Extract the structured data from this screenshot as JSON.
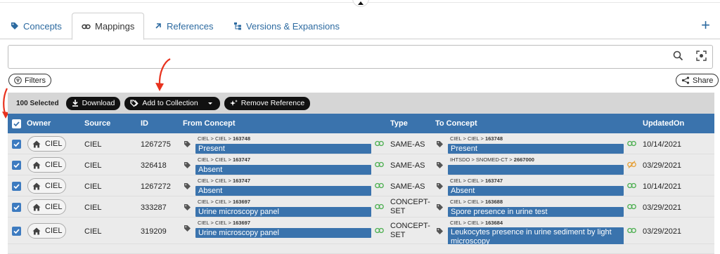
{
  "tabs": [
    {
      "label": "Concepts",
      "icon": "tag-icon"
    },
    {
      "label": "Mappings",
      "icon": "link-icon"
    },
    {
      "label": "References",
      "icon": "reference-icon"
    },
    {
      "label": "Versions & Expansions",
      "icon": "tree-icon"
    }
  ],
  "search": {
    "value": "",
    "placeholder": ""
  },
  "filters_label": "Filters",
  "share_label": "Share",
  "actions": {
    "selected": "100 Selected",
    "download": "Download",
    "add_to_collection": "Add to Collection",
    "remove_reference": "Remove Reference"
  },
  "columns": {
    "owner": "Owner",
    "source": "Source",
    "id": "ID",
    "from_concept": "From Concept",
    "type": "Type",
    "to_concept": "To Concept",
    "updated_on": "UpdatedOn"
  },
  "sep": ">",
  "rows": [
    {
      "owner": "CIEL",
      "source": "CIEL",
      "id": "1267275",
      "from": {
        "org": "CIEL",
        "src": "CIEL",
        "code": "163748",
        "name": "Present"
      },
      "type": "SAME-AS",
      "to": {
        "org": "CIEL",
        "src": "CIEL",
        "code": "163748",
        "name": "Present"
      },
      "to_link_status": "linked",
      "updated": "10/14/2021"
    },
    {
      "owner": "CIEL",
      "source": "CIEL",
      "id": "326418",
      "from": {
        "org": "CIEL",
        "src": "CIEL",
        "code": "163747",
        "name": "Absent"
      },
      "type": "SAME-AS",
      "to": {
        "org": "IHTSDO",
        "src": "SNOMED-CT",
        "code": "2667000",
        "name": ""
      },
      "to_link_status": "broken",
      "updated": "03/29/2021"
    },
    {
      "owner": "CIEL",
      "source": "CIEL",
      "id": "1267272",
      "from": {
        "org": "CIEL",
        "src": "CIEL",
        "code": "163747",
        "name": "Absent"
      },
      "type": "SAME-AS",
      "to": {
        "org": "CIEL",
        "src": "CIEL",
        "code": "163747",
        "name": "Absent"
      },
      "to_link_status": "linked",
      "updated": "10/14/2021"
    },
    {
      "owner": "CIEL",
      "source": "CIEL",
      "id": "333287",
      "from": {
        "org": "CIEL",
        "src": "CIEL",
        "code": "163697",
        "name": "Urine microscopy panel"
      },
      "type_line1": "CONCEPT-",
      "type_line2": "SET",
      "to": {
        "org": "CIEL",
        "src": "CIEL",
        "code": "163688",
        "name": "Spore presence in urine test"
      },
      "to_link_status": "linked",
      "updated": "03/29/2021"
    },
    {
      "owner": "CIEL",
      "source": "CIEL",
      "id": "319209",
      "from": {
        "org": "CIEL",
        "src": "CIEL",
        "code": "163697",
        "name": "Urine microscopy panel"
      },
      "type_line1": "CONCEPT-",
      "type_line2": "SET",
      "to": {
        "org": "CIEL",
        "src": "CIEL",
        "code": "163684",
        "name_line1": "Leukocytes presence in urine sediment by light",
        "name_line2": "microscopy"
      },
      "to_link_status": "linked",
      "updated": "03/29/2021"
    }
  ],
  "colors": {
    "primary": "#3a73ad",
    "accent_red": "#e8321e",
    "link_green": "#4caf50",
    "link_broken": "#e6a23c"
  }
}
